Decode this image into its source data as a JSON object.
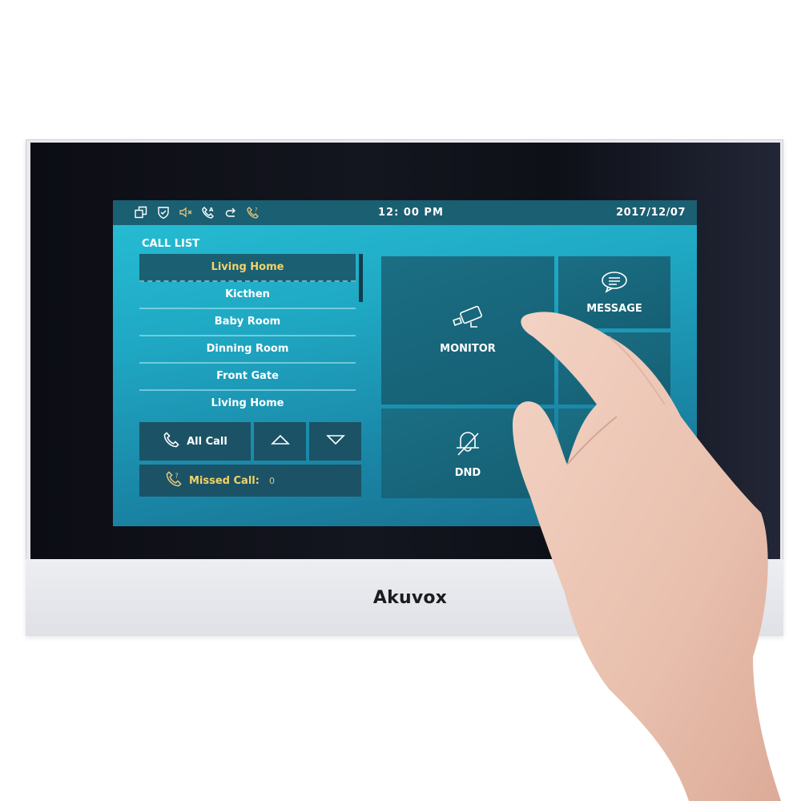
{
  "device": {
    "brand": "Akuvox"
  },
  "statusbar": {
    "icons": [
      {
        "name": "multi-window-icon",
        "color": "#ffffff"
      },
      {
        "name": "shield-check-icon",
        "color": "#ffffff"
      },
      {
        "name": "speaker-muted-icon",
        "color": "#e0c37a"
      },
      {
        "name": "phone-auto-answer-icon",
        "color": "#ffffff"
      },
      {
        "name": "forward-icon",
        "color": "#ffffff"
      },
      {
        "name": "phone-missed-icon",
        "color": "#e0c37a"
      }
    ],
    "time": "12: 00  PM",
    "date": "2017/12/07"
  },
  "call_list": {
    "title": "CALL LIST",
    "items": [
      {
        "label": "Living Home",
        "selected": true
      },
      {
        "label": "Kicthen",
        "selected": false
      },
      {
        "label": "Baby Room",
        "selected": false
      },
      {
        "label": "Dinning Room",
        "selected": false
      },
      {
        "label": "Front Gate",
        "selected": false
      },
      {
        "label": "Living Home",
        "selected": false
      }
    ],
    "all_call_label": "All Call",
    "up_icon": "triangle-up-icon",
    "down_icon": "triangle-down-icon",
    "missed_call_label": "Missed Call:",
    "missed_call_count": "0"
  },
  "tiles": {
    "monitor": {
      "label": "MONITOR",
      "icon": "camera-icon"
    },
    "message": {
      "label": "MESSAGE",
      "icon": "chat-bubble-icon"
    },
    "dnd": {
      "label": "DND",
      "icon": "bell-off-icon"
    }
  },
  "colors": {
    "screen_accent": "#27bfd6",
    "statusbar": "#1b5f72",
    "highlight_text": "#f2d36a",
    "tile": "#1b6e83"
  }
}
